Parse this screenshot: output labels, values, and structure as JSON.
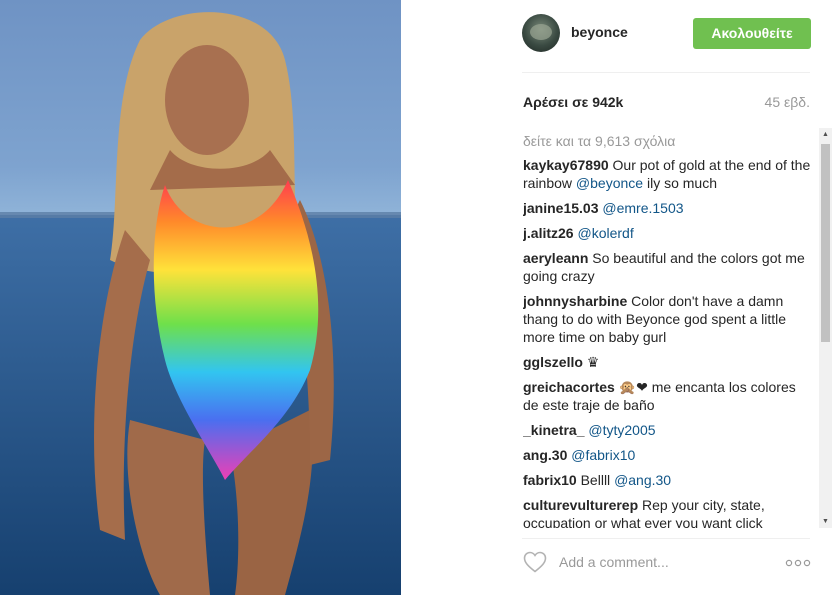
{
  "post": {
    "image_alt": "Woman in rainbow swimsuit by the sea"
  },
  "header": {
    "username": "beyonce",
    "follow_label": "Ακολουθείτε"
  },
  "stats": {
    "likes": "Αρέσει σε 942k",
    "time": "45 εβδ."
  },
  "comments": {
    "load_more": "δείτε και τα 9,613 σχόλια",
    "items": [
      {
        "author": "kaykay67890",
        "text": "Our pot of gold at the end of the rainbow ",
        "mention": "@beyonce",
        "after": " ily so much"
      },
      {
        "author": "janine15.03",
        "text": "",
        "mention": "@emre.1503",
        "after": ""
      },
      {
        "author": "j.alitz26",
        "text": "",
        "mention": "@kolerdf",
        "after": ""
      },
      {
        "author": "aeryleann",
        "text": "So beautiful and the colors got me going crazy",
        "mention": "",
        "after": ""
      },
      {
        "author": "johnnysharbine",
        "text": "Color don't have a damn thang to do with Beyonce god spent a little more time on baby gurl",
        "mention": "",
        "after": ""
      },
      {
        "author": "gglszello",
        "text": "♛",
        "mention": "",
        "after": ""
      },
      {
        "author": "greichacortes",
        "text": "🙊❤ me encanta los colores de este traje de baño",
        "mention": "",
        "after": ""
      },
      {
        "author": "_kinetra_",
        "text": "",
        "mention": "@tyty2005",
        "after": ""
      },
      {
        "author": "ang.30",
        "text": "",
        "mention": "@fabrix10",
        "after": ""
      },
      {
        "author": "fabrix10",
        "text": "Bellll ",
        "mention": "@ang.30",
        "after": ""
      },
      {
        "author": "culturevulturerep",
        "text": "Rep your city, state, occupation or what ever you want click",
        "mention": "",
        "after": ""
      }
    ]
  },
  "footer": {
    "comment_placeholder": "Add a comment..."
  },
  "icons": {
    "heart": "heart-icon",
    "more": "more-options-icon",
    "scroll_up": "scroll-up-icon",
    "scroll_down": "scroll-down-icon"
  },
  "colors": {
    "follow_button": "#70c050",
    "mention": "#125688",
    "muted": "#999999"
  }
}
